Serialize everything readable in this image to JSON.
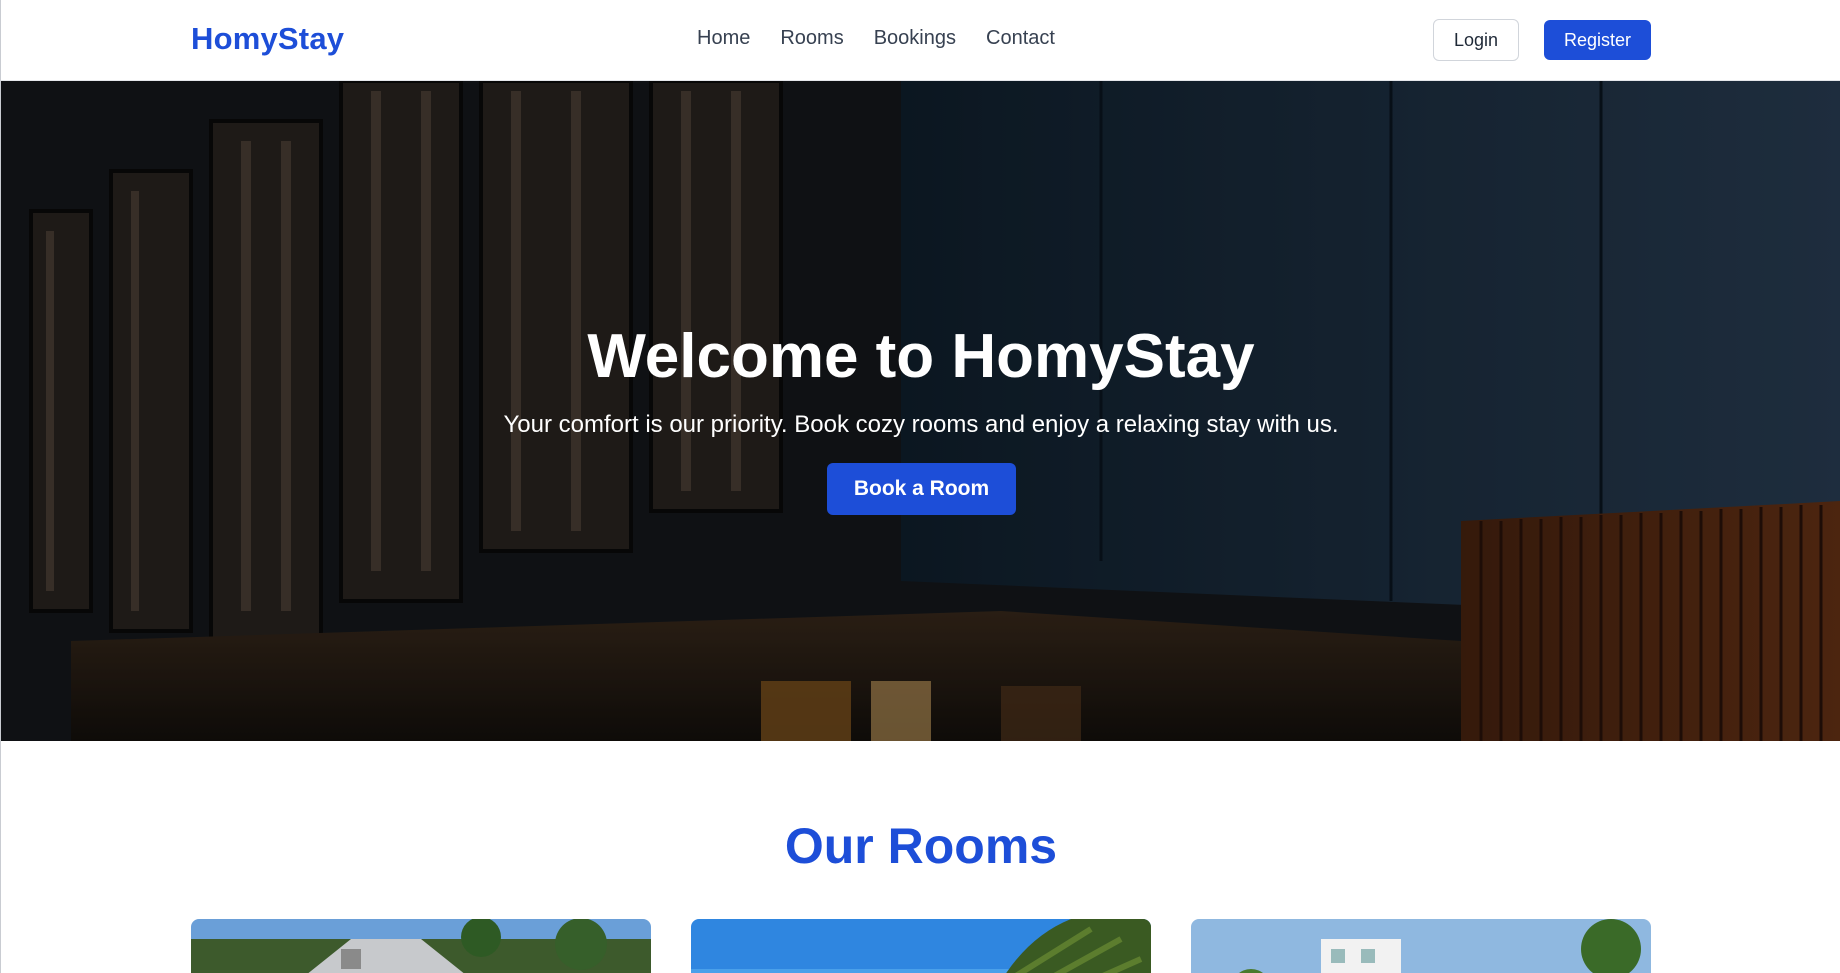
{
  "brand": {
    "name": "HomyStay",
    "color": "#1d4ed8"
  },
  "nav": {
    "links": [
      "Home",
      "Rooms",
      "Bookings",
      "Contact"
    ],
    "login_label": "Login",
    "register_label": "Register"
  },
  "hero": {
    "title": "Welcome to HomyStay",
    "subtitle": "Your comfort is our priority. Book cozy rooms and enjoy a relaxing stay with us.",
    "cta_label": "Book a Room"
  },
  "rooms": {
    "title": "Our Rooms",
    "cards": [
      {
        "image": "room-photo-1"
      },
      {
        "image": "room-photo-2"
      },
      {
        "image": "room-photo-3"
      }
    ]
  },
  "colors": {
    "accent": "#1d4ed8",
    "text": "#374151"
  }
}
